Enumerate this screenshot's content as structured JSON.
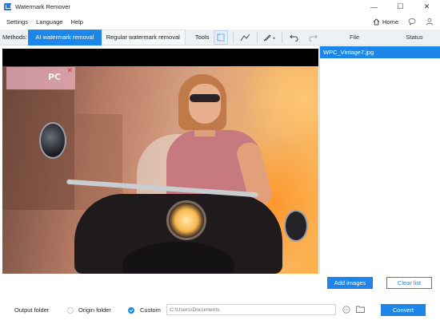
{
  "window": {
    "title": "Watermark Remover",
    "controls": {
      "minimize": "—",
      "maximize": "☐",
      "close": "✕"
    }
  },
  "menu": {
    "items": [
      "Settings",
      "Language",
      "Help"
    ],
    "home_label": "Home"
  },
  "toolbar": {
    "methods_label": "Methods:",
    "methods": [
      "AI watermark removal",
      "Regular watermark removal"
    ],
    "active_method": "AI watermark removal",
    "tools_label": "Tools",
    "tools": [
      "rectangle-select-icon",
      "lasso-icon",
      "brush-icon",
      "undo-icon",
      "redo-icon"
    ]
  },
  "file_panel": {
    "columns": [
      "File",
      "Status"
    ],
    "files": [
      {
        "name": "WPC_Vintage7.jpg",
        "status": ""
      }
    ],
    "add_button": "Add images",
    "clear_button": "Clear list"
  },
  "canvas": {
    "watermark_text": "PC",
    "watermark_close": "✕"
  },
  "output": {
    "label": "Output folder",
    "options": [
      "Origin folder",
      "Custom"
    ],
    "selected": "Custom",
    "path": "C:\\Users\\Documents",
    "convert_button": "Convert"
  },
  "colors": {
    "accent": "#1d86e8",
    "toolbar_bg": "#eef1f4",
    "watermark": "#e8afbe"
  }
}
